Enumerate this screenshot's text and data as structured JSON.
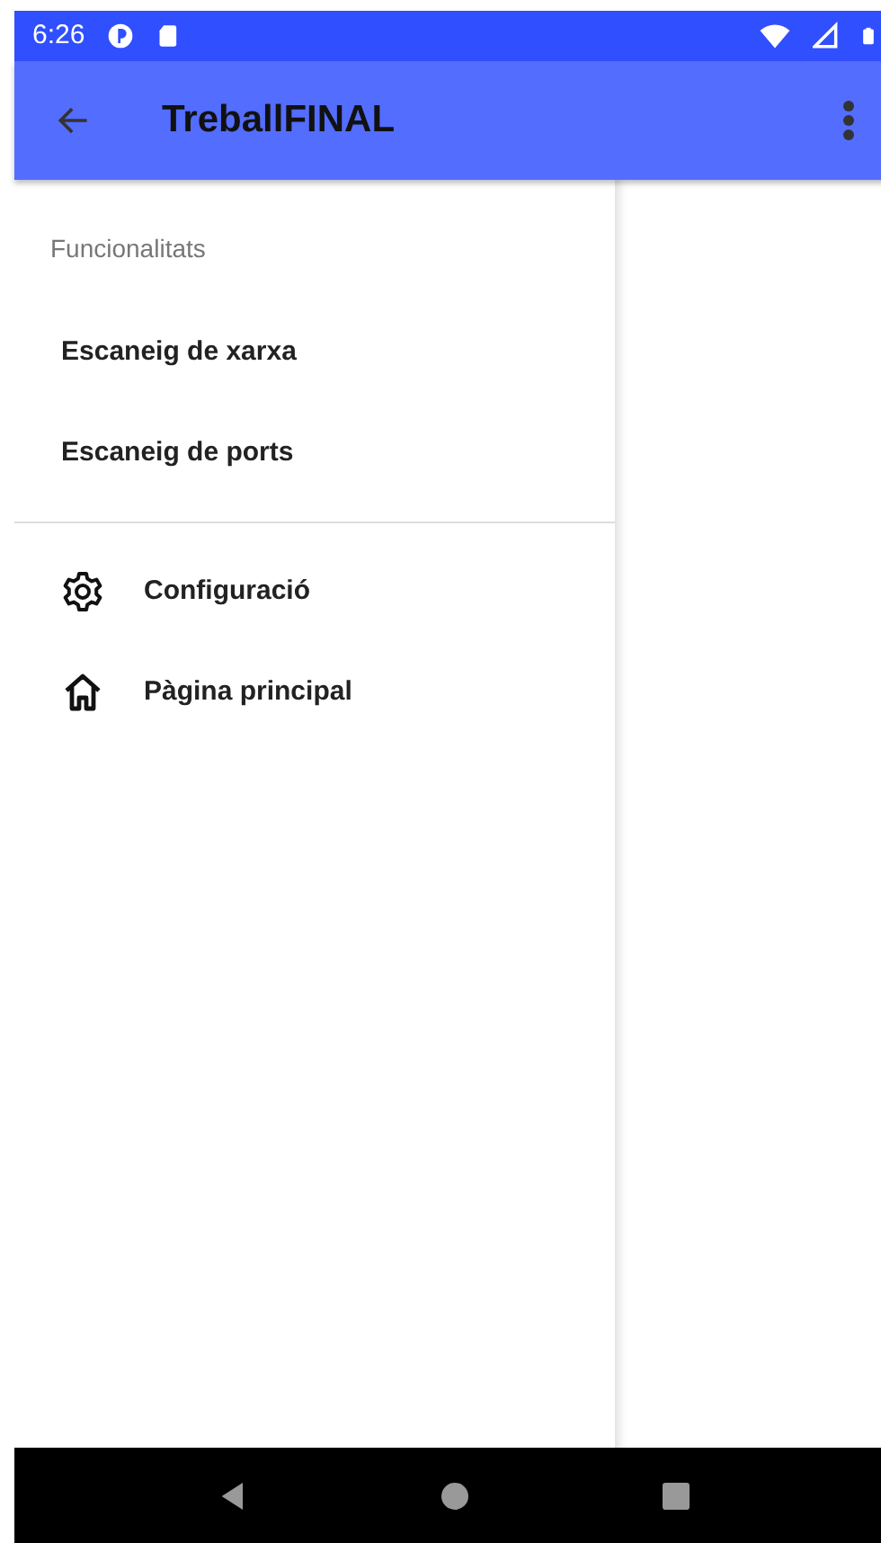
{
  "status_bar": {
    "time": "6:26"
  },
  "app_bar": {
    "title": "TreballFINAL"
  },
  "drawer": {
    "section_title": "Funcionalitats",
    "items": [
      {
        "kind": "plain",
        "label": "Escaneig de xarxa"
      },
      {
        "kind": "plain",
        "label": "Escaneig de ports"
      },
      {
        "kind": "divider"
      },
      {
        "kind": "settings",
        "label": "Configuració"
      },
      {
        "kind": "home",
        "label": "Pàgina principal"
      }
    ]
  }
}
